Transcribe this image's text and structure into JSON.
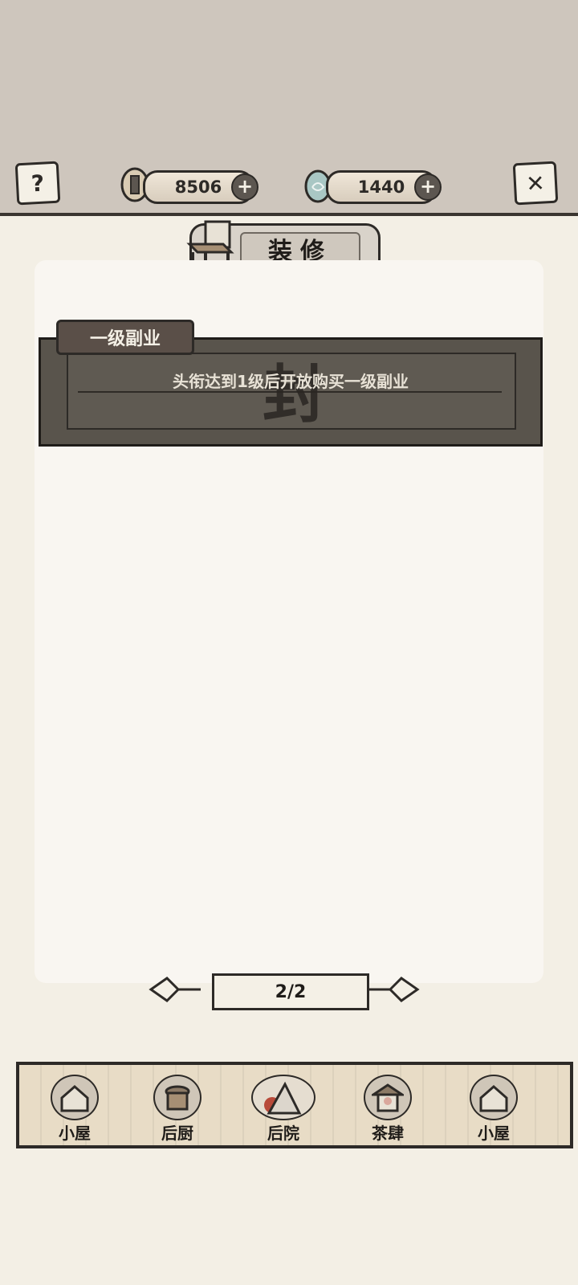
{
  "header": {
    "help_icon": "question-icon",
    "close_icon": "close-icon",
    "coins": {
      "value": "8506",
      "icon": "coin-icon"
    },
    "gems": {
      "value": "1440",
      "icon": "jade-egg-icon"
    }
  },
  "title": {
    "text": "装修",
    "icon": "chair-icon"
  },
  "rows": [
    {
      "tag": "一级副业",
      "locked_text": "头衔达到1级后开放购买一级副业",
      "seal_icon": "seal-icon"
    }
  ],
  "pager": {
    "current": "2/2"
  },
  "nav": [
    {
      "label": "小屋",
      "icon": "house-icon",
      "active": false
    },
    {
      "label": "后厨",
      "icon": "kitchen-icon",
      "active": false
    },
    {
      "label": "后院",
      "icon": "backyard-icon",
      "active": true
    },
    {
      "label": "茶肆",
      "icon": "teahouse-icon",
      "active": false
    },
    {
      "label": "小屋",
      "icon": "house-icon",
      "active": false
    }
  ],
  "colors": {
    "ink": "#2d2a27",
    "paper": "#f3efe5",
    "topbar": "#cec6bd",
    "locked": "#59544c"
  }
}
